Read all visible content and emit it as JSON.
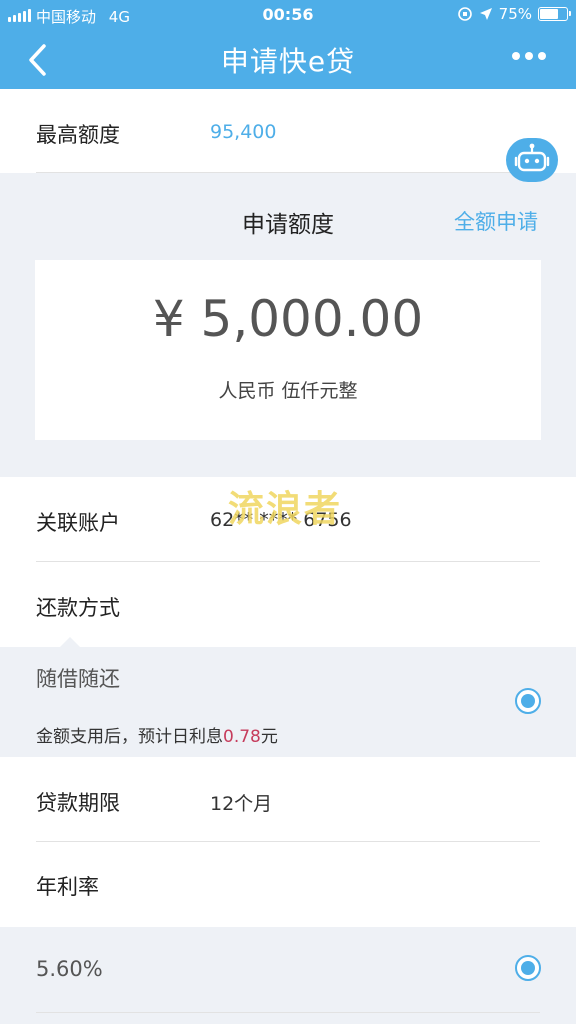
{
  "status": {
    "carrier": "中国移动",
    "network": "4G",
    "time": "00:56",
    "battery": "75%",
    "battery_level": 0.75
  },
  "nav": {
    "title": "申请快e贷",
    "back_icon": "chevron-left-icon",
    "more_icon": "more-dots-icon"
  },
  "max_amount": {
    "label": "最高额度",
    "value": "95,400"
  },
  "apply": {
    "title": "申请额度",
    "full_apply_link": "全额申请",
    "amount": "¥ 5,000.00",
    "amount_words": "人民币 伍仟元整"
  },
  "linked_account": {
    "label": "关联账户",
    "value": "62** **** 6756"
  },
  "repay_method": {
    "label": "还款方式",
    "option": "随借随还",
    "desc_prefix": "金额支用后，预计日利息",
    "desc_rate": "0.78",
    "desc_suffix": "元"
  },
  "term": {
    "label": "贷款期限",
    "value": "12个月"
  },
  "annual_rate": {
    "label": "年利率",
    "option": "5.60%"
  },
  "watermark": "流浪者",
  "colors": {
    "accent": "#4eaee8",
    "highlight": "#c63c5c"
  }
}
